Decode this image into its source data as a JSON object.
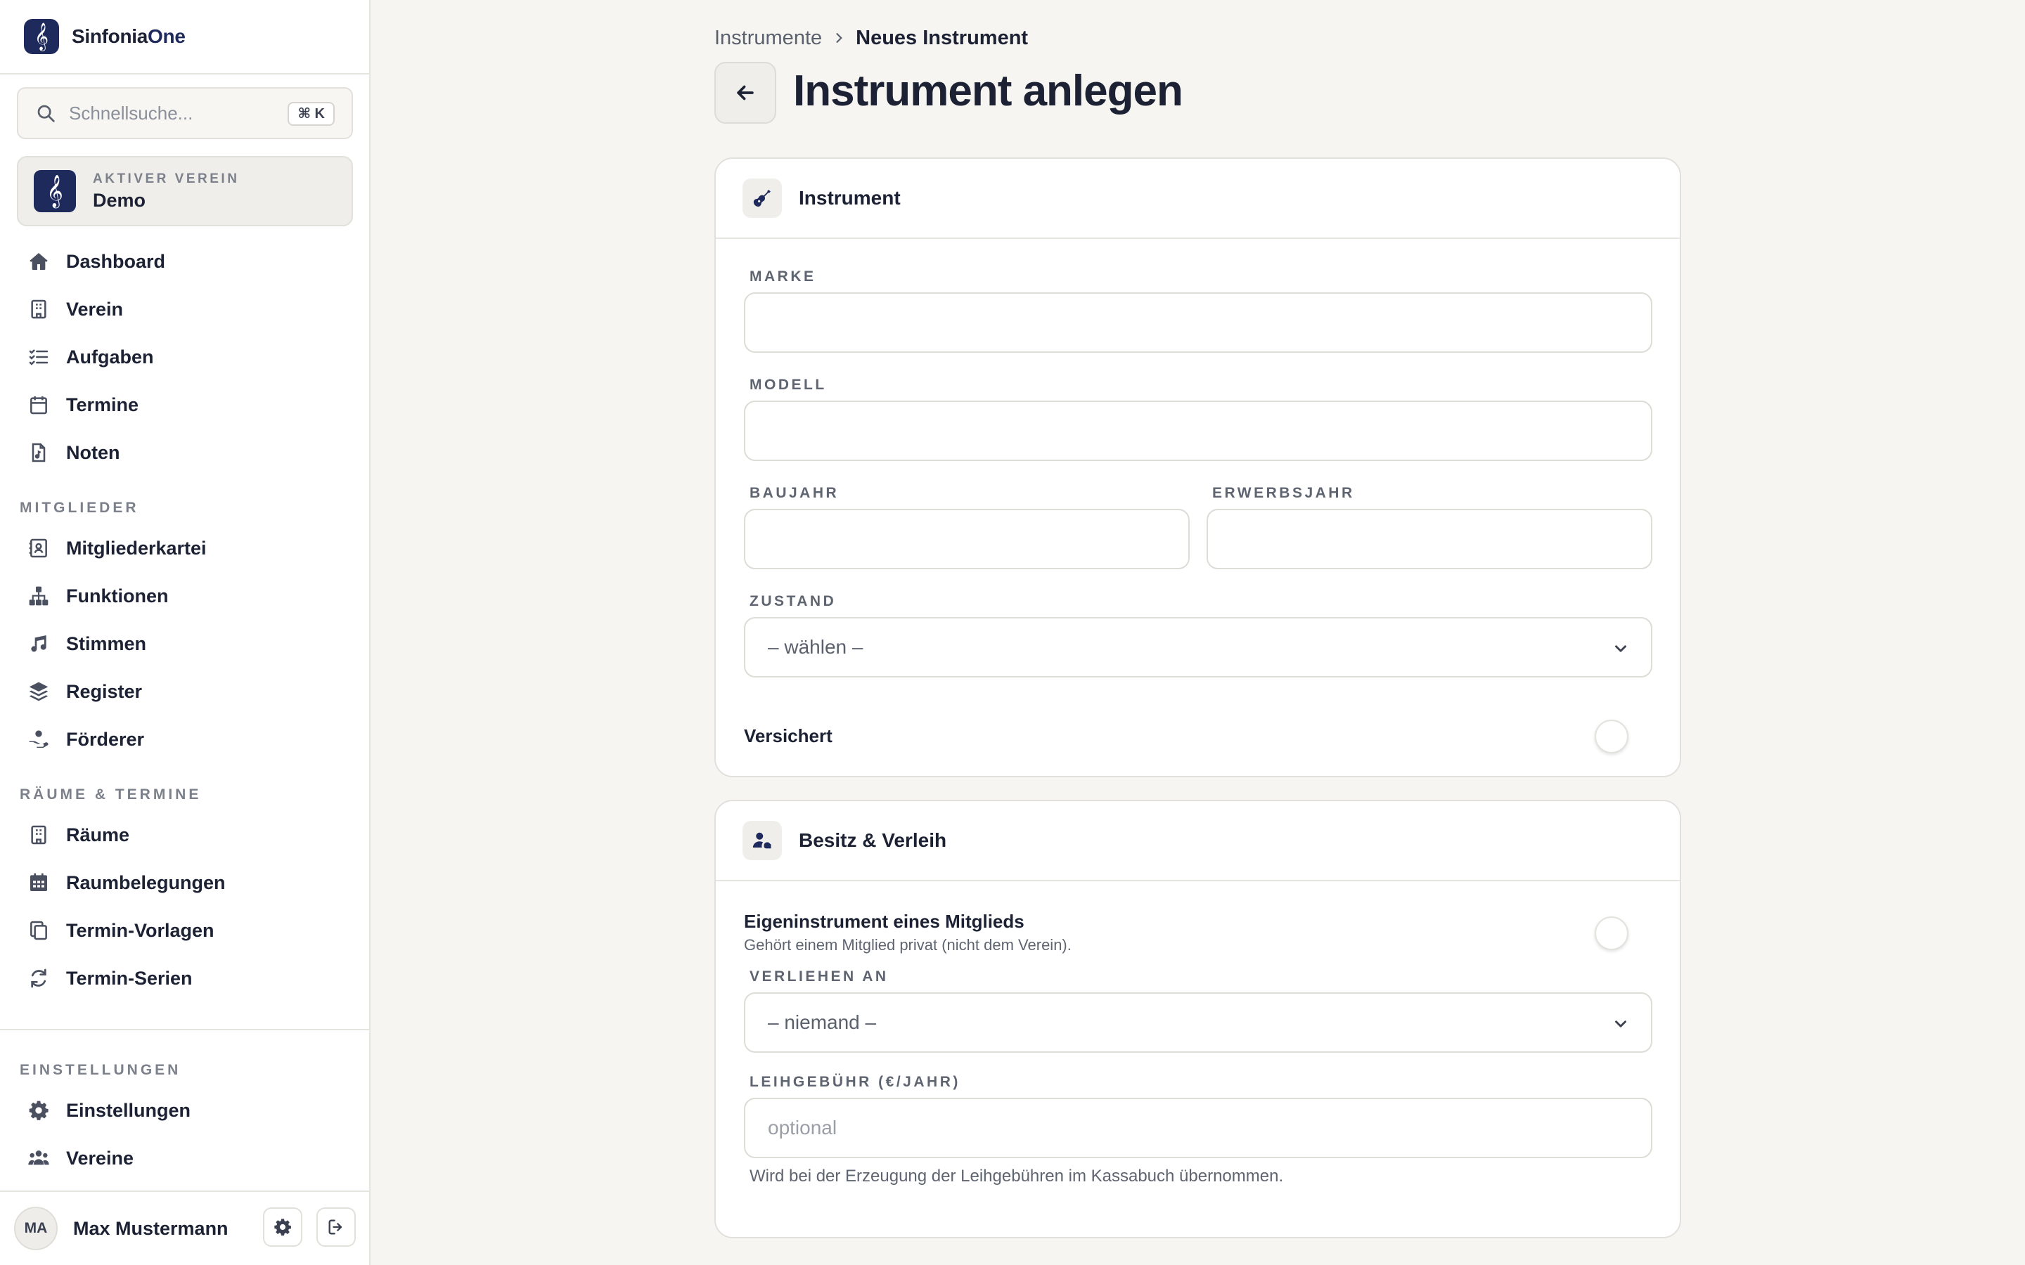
{
  "app": {
    "name_main": "Sinfonia",
    "name_accent": "One"
  },
  "search": {
    "placeholder": "Schnellsuche...",
    "shortcut": "⌘ K"
  },
  "active_club": {
    "kicker": "AKTIVER VEREIN",
    "name": "Demo"
  },
  "nav": {
    "main": [
      {
        "label": "Dashboard",
        "icon": "home-icon"
      },
      {
        "label": "Verein",
        "icon": "building-icon"
      },
      {
        "label": "Aufgaben",
        "icon": "checklist-icon"
      },
      {
        "label": "Termine",
        "icon": "calendar-icon"
      },
      {
        "label": "Noten",
        "icon": "sheet-music-icon"
      }
    ],
    "mitglieder_title": "MITGLIEDER",
    "mitglieder": [
      {
        "label": "Mitgliederkartei",
        "icon": "contact-card-icon"
      },
      {
        "label": "Funktionen",
        "icon": "org-chart-icon"
      },
      {
        "label": "Stimmen",
        "icon": "music-note-icon"
      },
      {
        "label": "Register",
        "icon": "layers-icon"
      },
      {
        "label": "Förderer",
        "icon": "donor-hand-icon"
      }
    ],
    "raeume_title": "RÄUME & TERMINE",
    "raeume": [
      {
        "label": "Räume",
        "icon": "building-icon"
      },
      {
        "label": "Raumbelegungen",
        "icon": "calendar-grid-icon"
      },
      {
        "label": "Termin-Vorlagen",
        "icon": "copy-icon"
      },
      {
        "label": "Termin-Serien",
        "icon": "refresh-icon"
      }
    ],
    "einstellungen_title": "EINSTELLUNGEN",
    "einstellungen": [
      {
        "label": "Einstellungen",
        "icon": "gear-icon"
      },
      {
        "label": "Vereine",
        "icon": "users-icon"
      }
    ]
  },
  "user": {
    "initials": "MA",
    "name": "Max Mustermann"
  },
  "breadcrumb": {
    "parent": "Instrumente",
    "current": "Neues Instrument"
  },
  "page": {
    "title": "Instrument anlegen"
  },
  "card_instrument": {
    "title": "Instrument",
    "marke_label": "MARKE",
    "modell_label": "MODELL",
    "baujahr_label": "BAUJAHR",
    "erwerbsjahr_label": "ERWERBSJAHR",
    "zustand_label": "ZUSTAND",
    "zustand_value": "– wählen –",
    "versichert_label": "Versichert"
  },
  "card_besitz": {
    "title": "Besitz & Verleih",
    "eigen_label": "Eigeninstrument eines Mitglieds",
    "eigen_sub": "Gehört einem Mitglied privat (nicht dem Verein).",
    "verliehen_label": "VERLIEHEN AN",
    "verliehen_value": "– niemand –",
    "gebuehr_label": "LEIHGEBÜHR (€/JAHR)",
    "gebuehr_placeholder": "optional",
    "gebuehr_hint": "Wird bei der Erzeugung der Leihgebühren im Kassabuch übernommen."
  },
  "colors": {
    "brand": "#1f2a5c",
    "text": "#1c2233",
    "muted": "#7b808a",
    "background": "#f6f5f2"
  }
}
